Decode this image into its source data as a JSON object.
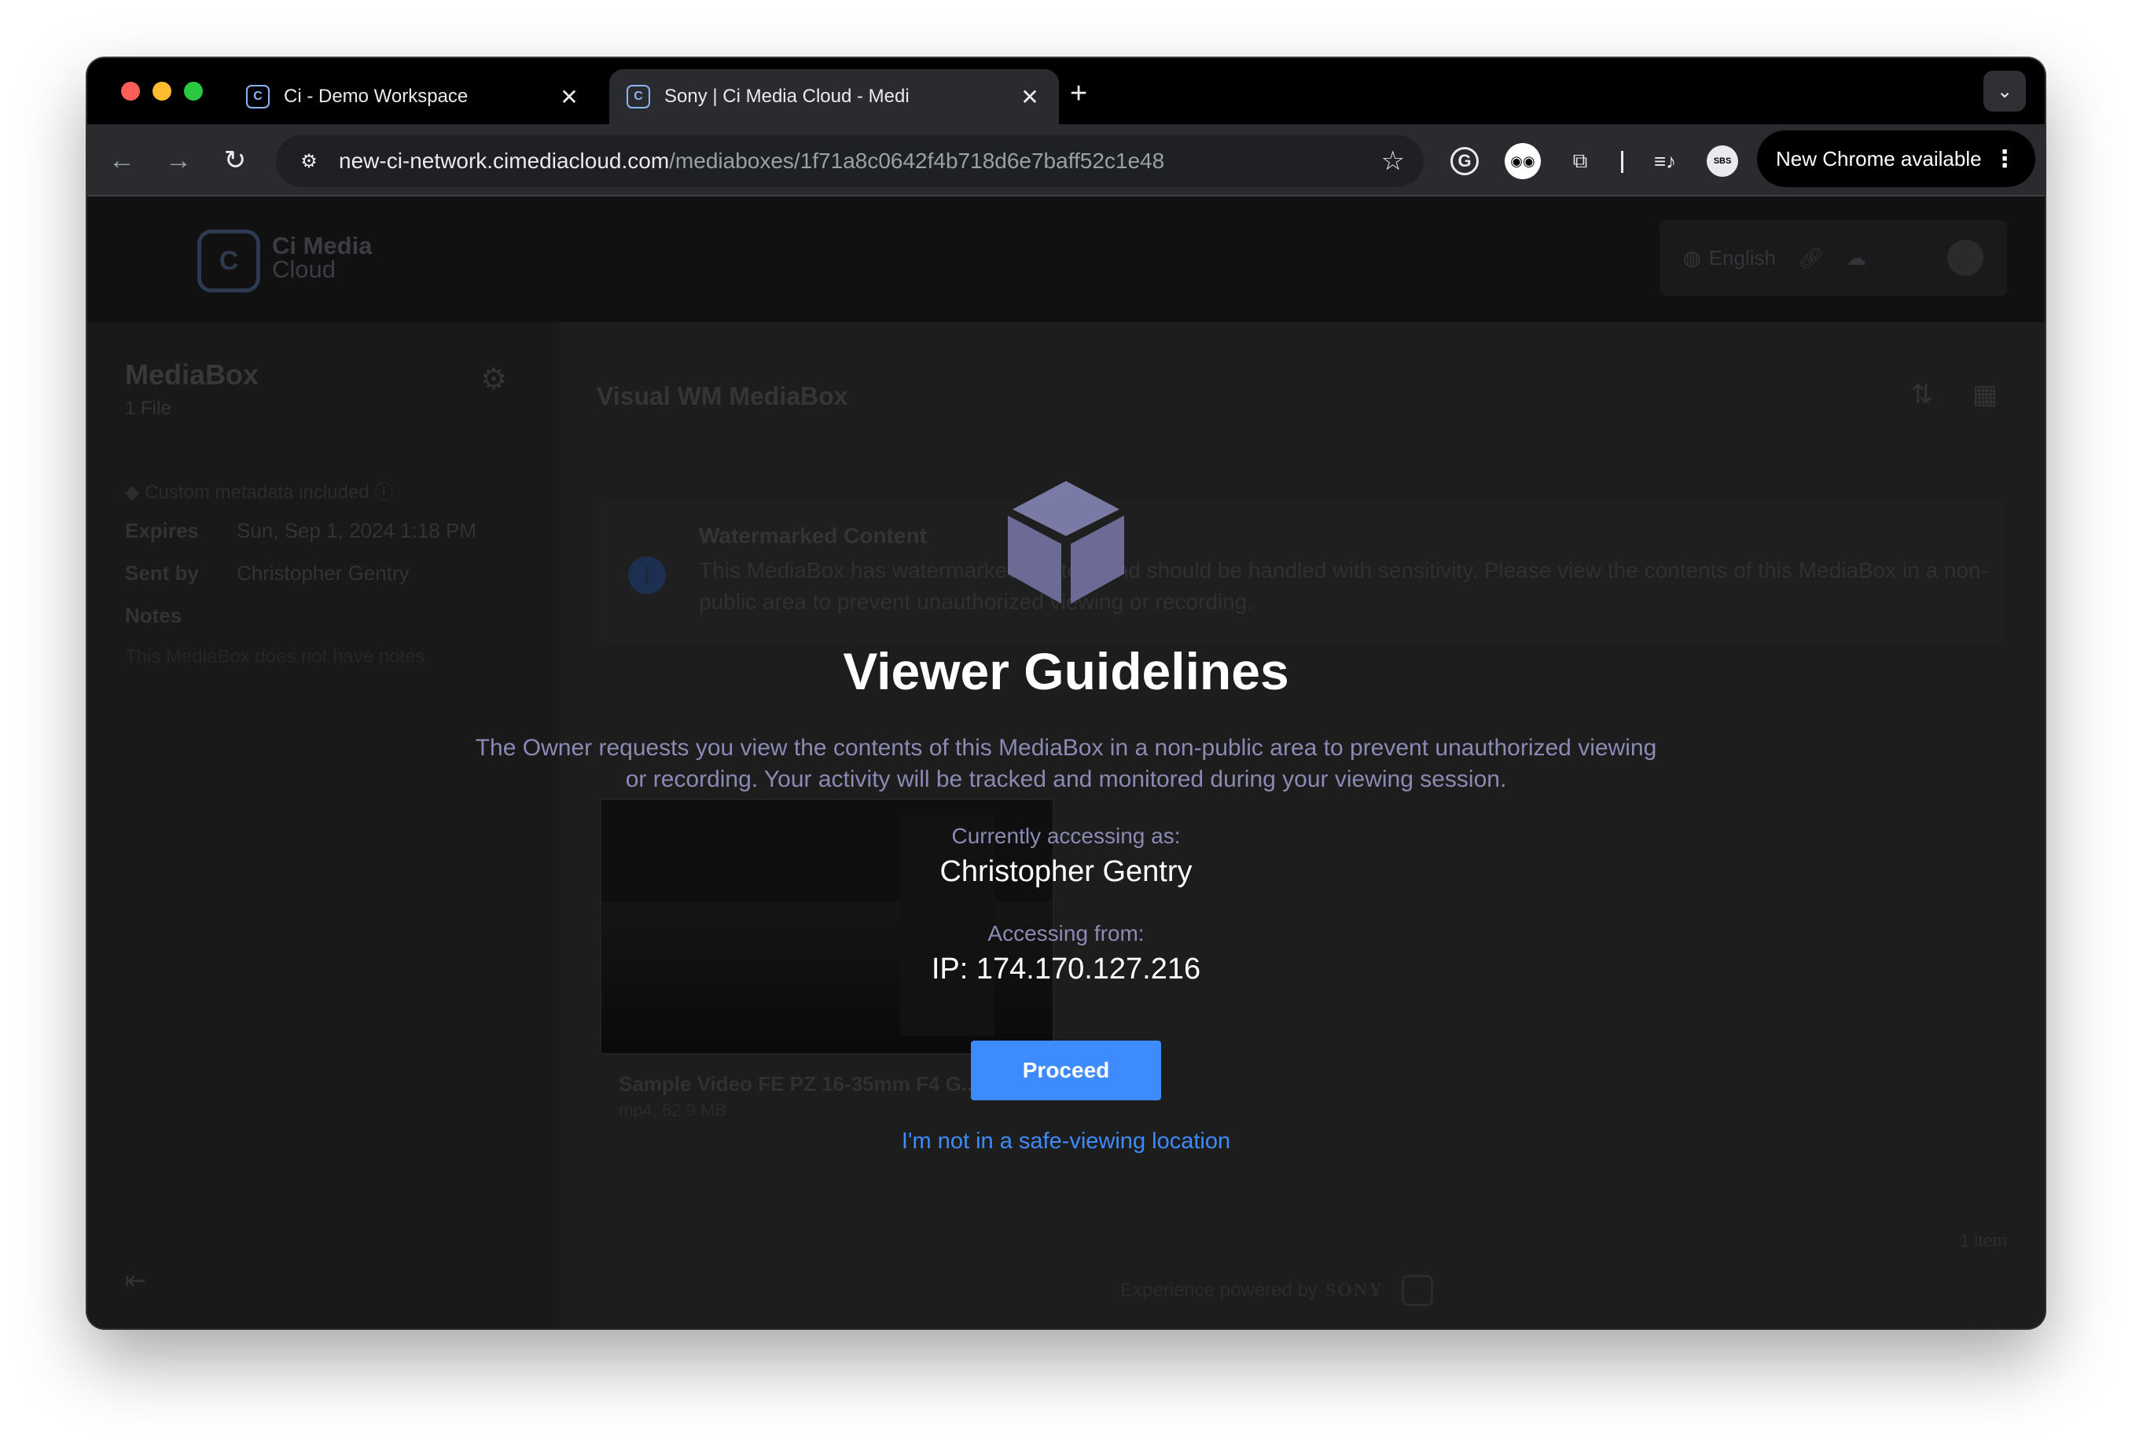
{
  "browser": {
    "tabs": [
      {
        "title": "Ci - Demo Workspace",
        "favicon": "C"
      },
      {
        "title": "Sony | Ci Media Cloud - Medi",
        "favicon": "C"
      }
    ],
    "url_host": "new-ci-network.cimediacloud.com",
    "url_path": "/mediaboxes/1f71a8c0642f4b718d6e7baff52c1e48",
    "update_button": "New Chrome available",
    "extension_sbs": "SBS"
  },
  "app": {
    "logo_text": "Ci Media",
    "logo_subtext": "Cloud",
    "language": "English",
    "sidebar": {
      "title": "MediaBox",
      "file_count": "1 File",
      "custom_metadata": "Custom metadata included",
      "expires_label": "Expires",
      "expires_value": "Sun, Sep 1, 2024 1:18 PM",
      "sent_by_label": "Sent by",
      "sent_by_value": "Christopher Gentry",
      "notes_label": "Notes",
      "notes_empty": "This MediaBox does not have notes"
    },
    "main": {
      "title": "Visual WM MediaBox",
      "notice_title": "Watermarked Content",
      "notice_body": "This MediaBox has watermarked content and should be handled with sensitivity. Please view the contents of this MediaBox in a non-public area to prevent unauthorized viewing or recording.",
      "file_name": "Sample Video FE PZ 16-35mm F4 G...",
      "file_meta": "mp4, 62.9 MB",
      "item_count": "1 item"
    },
    "footer": {
      "powered_by": "Experience powered by",
      "brand": "SONY"
    }
  },
  "modal": {
    "title": "Viewer Guidelines",
    "description": "The Owner requests you view the contents of this MediaBox in a non-public area to prevent unauthorized viewing or recording. Your activity will be tracked and monitored during your viewing session.",
    "accessing_as_label": "Currently accessing as:",
    "accessing_as_value": "Christopher Gentry",
    "accessing_from_label": "Accessing from:",
    "accessing_from_value": "IP: 174.170.127.216",
    "proceed_label": "Proceed",
    "unsafe_link": "I'm not in a safe-viewing location"
  },
  "colors": {
    "accent": "#3d8bfd",
    "muted_text": "#8a8ab4",
    "box_icon": "#6b6b96"
  }
}
